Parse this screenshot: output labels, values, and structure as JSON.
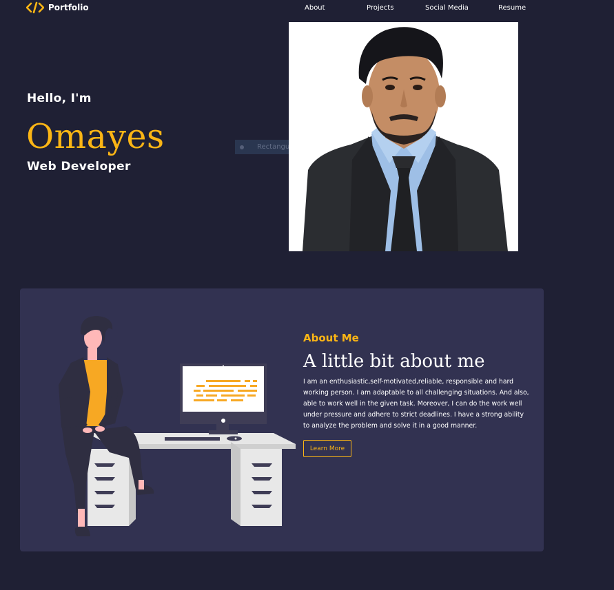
{
  "nav": {
    "logo_icon": "code-icon",
    "logo_text": "Portfolio",
    "links": [
      "About",
      "Projects",
      "Social Media",
      "Resume"
    ]
  },
  "hero": {
    "greeting": "Hello, I'm",
    "name": "Omayes",
    "role": "Web Developer"
  },
  "overlay": {
    "snip_label": "Rectangular Snip"
  },
  "about": {
    "heading": "About Me",
    "title": "A little bit about me",
    "text": "I am an enthusiastic,self-motivated,reliable, responsible and hard working person. I am adaptable to all challenging situations. And also, able to work well in the given task. Moreover, I can do the work well under pressure and adhere to strict deadlines. I have a strong ability to analyze the problem and solve it in a good manner.",
    "button": "Learn More"
  },
  "colors": {
    "background": "#1f2034",
    "card": "#323251",
    "accent": "#fbb515",
    "text": "#ffffff"
  }
}
